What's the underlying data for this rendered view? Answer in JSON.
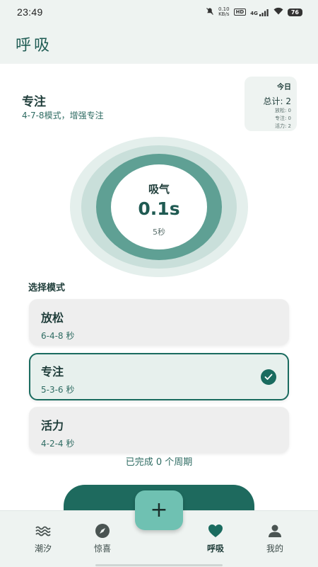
{
  "status_bar": {
    "time": "23:49",
    "net_speed_value": "0.10",
    "net_speed_unit": "KB/s",
    "hd": "HD",
    "network": "4G",
    "battery": "76"
  },
  "header": {
    "title": "呼吸"
  },
  "current_mode": {
    "name": "专注",
    "description": "4-7-8模式，增强专注"
  },
  "today_stats": {
    "label": "今日",
    "total": "总计: 2",
    "lines": [
      "放松: 0",
      "专注: 0",
      "活力: 2"
    ]
  },
  "breath": {
    "phase": "吸气",
    "timer": "0.1s",
    "duration": "5秒"
  },
  "mode_selector": {
    "label": "选择模式",
    "modes": [
      {
        "name": "放松",
        "pattern": "6-4-8 秒",
        "selected": false
      },
      {
        "name": "专注",
        "pattern": "5-3-6 秒",
        "selected": true
      },
      {
        "name": "活力",
        "pattern": "4-2-4 秒",
        "selected": false
      }
    ]
  },
  "cycles_text": "已完成 0 个周期",
  "fab": {
    "icon": "plus-icon",
    "label": "+"
  },
  "bottom_nav": {
    "items": [
      {
        "label": "潮汐",
        "icon": "waves-icon",
        "active": false
      },
      {
        "label": "惊喜",
        "icon": "compass-icon",
        "active": false
      },
      {
        "label": "呼吸",
        "icon": "heart-icon",
        "active": true
      },
      {
        "label": "我的",
        "icon": "person-icon",
        "active": false
      }
    ]
  },
  "colors": {
    "primary": "#1a6b5f",
    "accent": "#6fc1b2",
    "background": "#eef3f1"
  }
}
